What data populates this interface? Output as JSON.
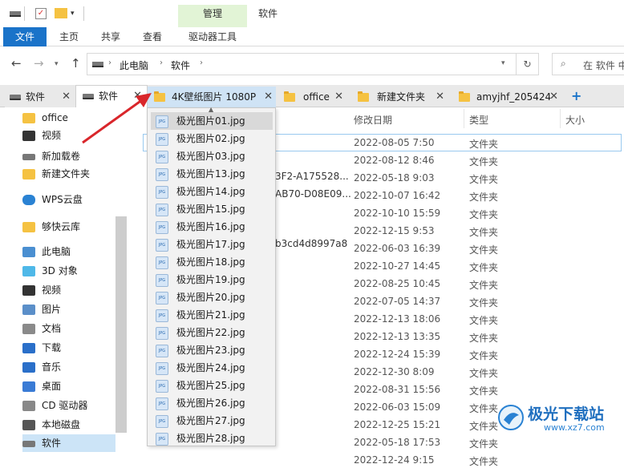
{
  "ribbon": {
    "context_group": "管理",
    "context_title": "软件",
    "tabs": [
      "文件",
      "主页",
      "共享",
      "查看",
      "驱动器工具"
    ]
  },
  "address": {
    "path": [
      "此电脑",
      "软件"
    ],
    "search_placeholder": "在 软件 中"
  },
  "tabs": [
    {
      "label": "软件",
      "icon": "drive-icon"
    },
    {
      "label": "软件",
      "icon": "drive-icon",
      "active": true
    },
    {
      "label": "4K壁纸图片 1080P",
      "icon": "folder-icon"
    },
    {
      "label": "office",
      "icon": "folder-icon"
    },
    {
      "label": "新建文件夹",
      "icon": "folder-icon"
    },
    {
      "label": "amyjhf_205424",
      "icon": "folder-icon"
    }
  ],
  "add_tab": "+",
  "sidebar": [
    {
      "label": "office",
      "icon": "folder-icon"
    },
    {
      "label": "视频",
      "icon": "video-icon"
    },
    {
      "label": "新加载卷",
      "icon": "drive-icon"
    },
    {
      "label": "新建文件夹",
      "icon": "folder-icon"
    },
    {
      "label": "WPS云盘",
      "icon": "cloud-icon"
    },
    {
      "label": "够快云库",
      "icon": "folder-icon"
    },
    {
      "label": "此电脑",
      "icon": "computer-icon"
    },
    {
      "label": "3D 对象",
      "icon": "cube-icon"
    },
    {
      "label": "视频",
      "icon": "video-icon"
    },
    {
      "label": "图片",
      "icon": "picture-icon"
    },
    {
      "label": "文档",
      "icon": "document-icon"
    },
    {
      "label": "下载",
      "icon": "download-icon"
    },
    {
      "label": "音乐",
      "icon": "music-icon"
    },
    {
      "label": "桌面",
      "icon": "desktop-icon"
    },
    {
      "label": "CD 驱动器",
      "icon": "cd-icon"
    },
    {
      "label": "本地磁盘",
      "icon": "disk-icon"
    },
    {
      "label": "软件",
      "icon": "drive-icon"
    }
  ],
  "columns": {
    "modified": "修改日期",
    "type": "类型",
    "size": "大小"
  },
  "name_fragments": [
    "3F2-A175528...",
    "AB70-D08E09...",
    "b3cd4d8997a8"
  ],
  "rows": [
    {
      "date": "2022-08-05 7:50",
      "type": "文件夹"
    },
    {
      "date": "2022-08-12 8:46",
      "type": "文件夹"
    },
    {
      "date": "2022-05-18 9:03",
      "type": "文件夹"
    },
    {
      "date": "2022-10-07 16:42",
      "type": "文件夹"
    },
    {
      "date": "2022-10-10 15:59",
      "type": "文件夹"
    },
    {
      "date": "2022-12-15 9:53",
      "type": "文件夹"
    },
    {
      "date": "2022-06-03 16:39",
      "type": "文件夹"
    },
    {
      "date": "2022-10-27 14:45",
      "type": "文件夹"
    },
    {
      "date": "2022-08-25 10:45",
      "type": "文件夹"
    },
    {
      "date": "2022-07-05 14:37",
      "type": "文件夹"
    },
    {
      "date": "2022-12-13 18:06",
      "type": "文件夹"
    },
    {
      "date": "2022-12-13 13:35",
      "type": "文件夹"
    },
    {
      "date": "2022-12-24 15:39",
      "type": "文件夹"
    },
    {
      "date": "2022-12-30 8:09",
      "type": "文件夹"
    },
    {
      "date": "2022-08-31 15:56",
      "type": "文件夹"
    },
    {
      "date": "2022-06-03 15:09",
      "type": "文件夹"
    },
    {
      "date": "2022-12-25 15:21",
      "type": "文件夹"
    },
    {
      "date": "2022-05-18 17:53",
      "type": "文件夹"
    },
    {
      "date": "2022-12-24 9:15",
      "type": "文件夹"
    }
  ],
  "dropdown": [
    "极光图片01.jpg",
    "极光图片02.jpg",
    "极光图片03.jpg",
    "极光图片13.jpg",
    "极光图片14.jpg",
    "极光图片15.jpg",
    "极光图片16.jpg",
    "极光图片17.jpg",
    "极光图片18.jpg",
    "极光图片19.jpg",
    "极光图片20.jpg",
    "极光图片21.jpg",
    "极光图片22.jpg",
    "极光图片23.jpg",
    "极光图片24.jpg",
    "极光图片25.jpg",
    "极光图片26.jpg",
    "极光图片27.jpg",
    "极光图片28.jpg"
  ],
  "watermark": {
    "text": "极光下载站",
    "url": "www.xz7.com"
  },
  "colors": {
    "accent": "#1a73c9",
    "context_tab": "#e2f4d6",
    "arrow": "#d9262b"
  }
}
